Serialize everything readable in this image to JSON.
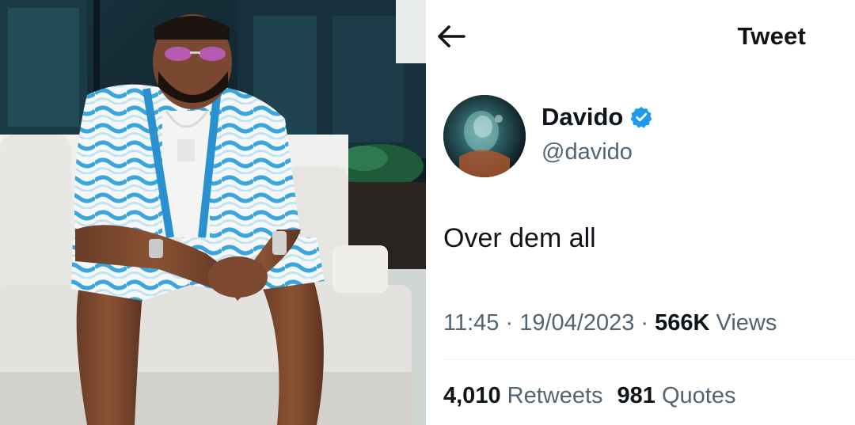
{
  "header": {
    "title": "Tweet",
    "back_icon": "arrow-left-icon"
  },
  "author": {
    "display_name": "Davido",
    "handle": "@davido",
    "verified_icon": "verified-badge-icon",
    "verified_color": "#1d9bf0"
  },
  "tweet": {
    "text": "Over dem all",
    "time": "11:45",
    "dot1": " · ",
    "date": "19/04/2023",
    "dot2": " · ",
    "views_count": "566K",
    "views_label": "Views"
  },
  "stats": {
    "retweets_count": "4,010",
    "retweets_label": "Retweets",
    "quotes_count": "981",
    "quotes_label": "Quotes"
  },
  "colors": {
    "text_primary": "#0f1419",
    "text_secondary": "#536471",
    "accent": "#1d9bf0"
  }
}
